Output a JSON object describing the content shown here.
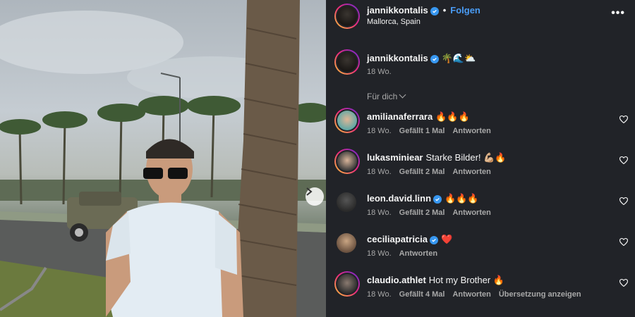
{
  "header": {
    "username": "jannikkontalis",
    "separator": "•",
    "follow_label": "Folgen",
    "location": "Mallorca, Spain",
    "more_icon": "•••"
  },
  "caption": {
    "username": "jannikkontalis",
    "emoji": "🌴🌊⛅",
    "time": "18 Wo."
  },
  "filter": {
    "label": "Für dich"
  },
  "comments": [
    {
      "username": "amilianaferrara",
      "verified": false,
      "text": "🔥🔥🔥",
      "time": "18 Wo.",
      "likes": "Gefällt 1 Mal",
      "reply": "Antworten",
      "translate": ""
    },
    {
      "username": "lukasminiear",
      "verified": false,
      "text": "Starke Bilder! 💪🏼🔥",
      "time": "18 Wo.",
      "likes": "Gefällt 2 Mal",
      "reply": "Antworten",
      "translate": ""
    },
    {
      "username": "leon.david.linn",
      "verified": true,
      "text": "🔥🔥🔥",
      "time": "18 Wo.",
      "likes": "Gefällt 2 Mal",
      "reply": "Antworten",
      "translate": ""
    },
    {
      "username": "ceciliapatricia",
      "verified": true,
      "text": "❤️",
      "time": "18 Wo.",
      "likes": "",
      "reply": "Antworten",
      "translate": ""
    },
    {
      "username": "claudio.athlet",
      "verified": false,
      "text": "Hot my Brother 🔥",
      "time": "18 Wo.",
      "likes": "Gefällt 4 Mal",
      "reply": "Antworten",
      "translate": "Übersetzung anzeigen"
    }
  ],
  "colors": {
    "panel_bg": "#212328",
    "accent": "#4a9cf5",
    "verified": "#3797f0",
    "muted": "#a8a8a8"
  }
}
